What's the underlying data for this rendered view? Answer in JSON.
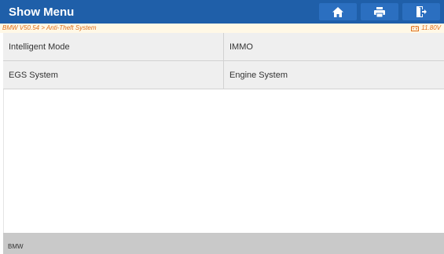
{
  "header": {
    "title": "Show Menu",
    "buttons": [
      {
        "icon": "home-icon"
      },
      {
        "icon": "print-icon"
      },
      {
        "icon": "exit-icon"
      }
    ]
  },
  "breadcrumb": {
    "path": "BMW V50.54 > Anti-Theft System",
    "voltage": "11.80V",
    "voltage_icon": "battery-icon"
  },
  "menu": {
    "items": [
      {
        "label": "Intelligent Mode"
      },
      {
        "label": "IMMO"
      },
      {
        "label": "EGS System"
      },
      {
        "label": "Engine System"
      }
    ]
  },
  "footer": {
    "label": "BMW"
  },
  "colors": {
    "header": "#1f5fa9",
    "breadcrumb_text": "#e0701a",
    "cell_bg": "#efefef",
    "footer_bg": "#c9c9c9"
  }
}
